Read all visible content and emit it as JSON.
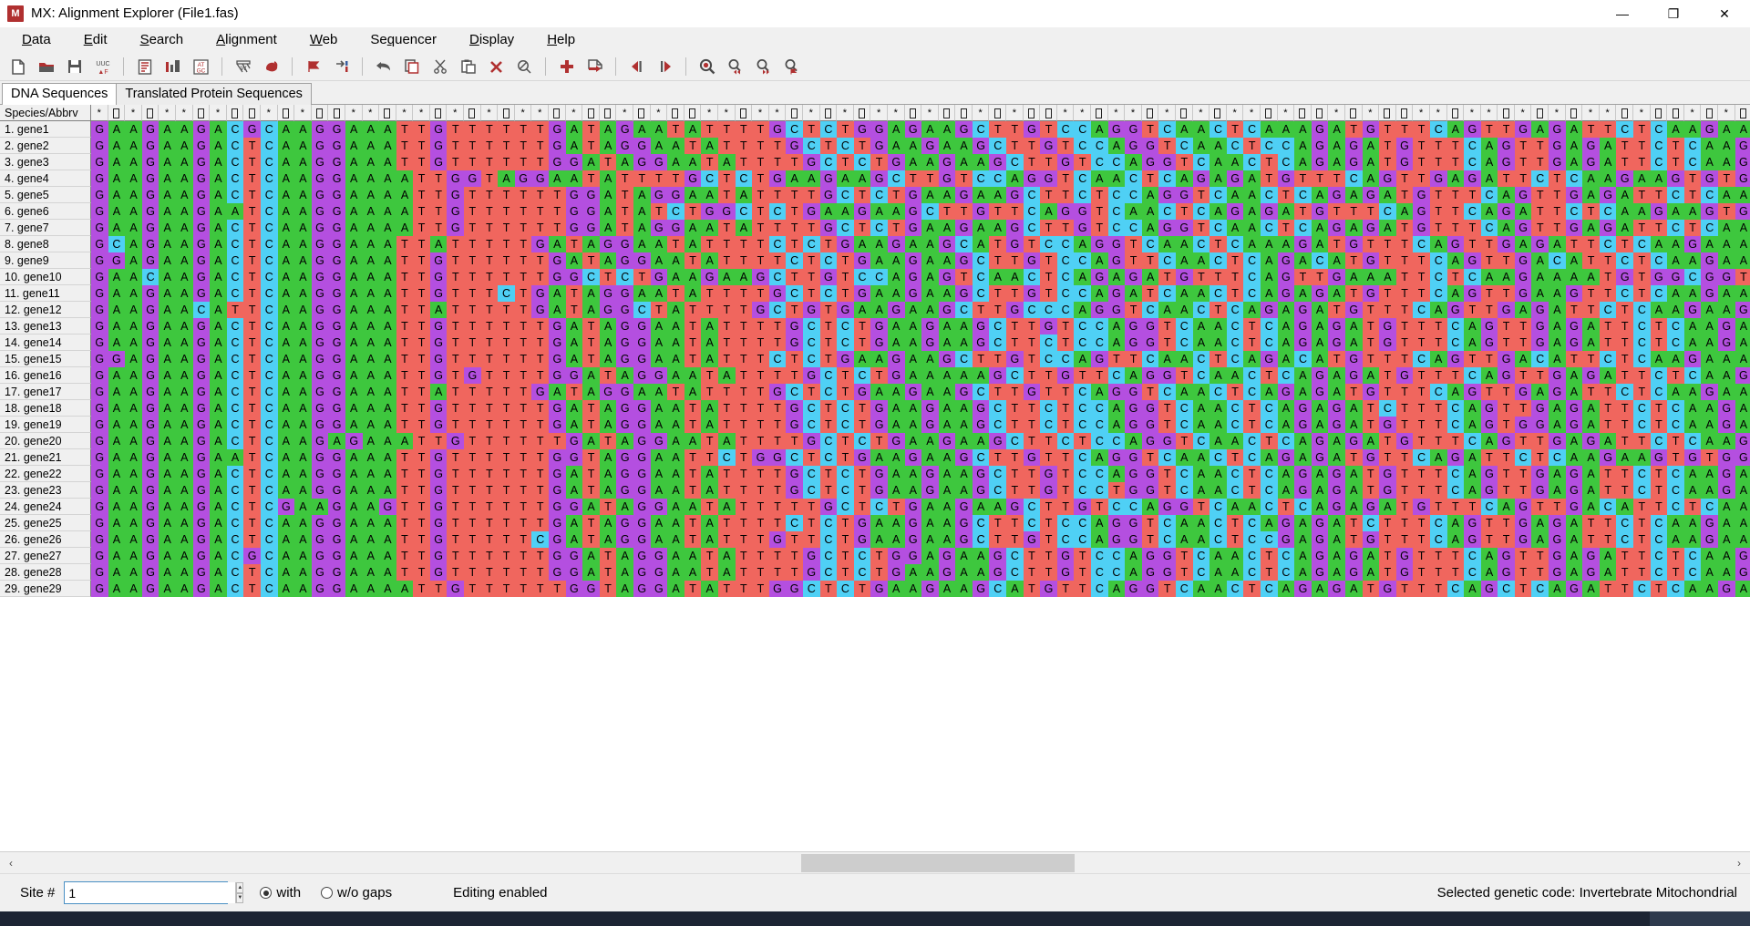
{
  "window": {
    "title": "MX: Alignment Explorer (File1.fas)",
    "app_icon_label": "M",
    "icon_color": "#b03030",
    "minimize": "—",
    "maximize": "❐",
    "close": "✕"
  },
  "menubar": {
    "items": [
      {
        "label": "Data",
        "mnemonic": "D"
      },
      {
        "label": "Edit",
        "mnemonic": "E"
      },
      {
        "label": "Search",
        "mnemonic": "S"
      },
      {
        "label": "Alignment",
        "mnemonic": "A"
      },
      {
        "label": "Web",
        "mnemonic": "W"
      },
      {
        "label": "Sequencer",
        "mnemonic": "q"
      },
      {
        "label": "Display",
        "mnemonic": "D"
      },
      {
        "label": "Help",
        "mnemonic": "H"
      }
    ]
  },
  "toolbar": {
    "buttons": [
      {
        "name": "new-file-icon",
        "glyph": "🗋",
        "color": "#555555"
      },
      {
        "name": "open-folder-icon",
        "glyph": "📁",
        "color": "#b03030"
      },
      {
        "name": "save-icon",
        "glyph": "💾",
        "color": "#555555"
      },
      {
        "name": "codon-uuc-icon",
        "glyph": "UUC",
        "color": "#555555"
      },
      {
        "name": "separator-1",
        "glyph": "",
        "color": ""
      },
      {
        "name": "text-file-icon",
        "glyph": "📄",
        "color": "#b03030"
      },
      {
        "name": "bar-chart-icon",
        "glyph": "▐▐",
        "color": "#b03030"
      },
      {
        "name": "at-gc-icon",
        "glyph": "AT",
        "color": "#b03030"
      },
      {
        "name": "separator-2",
        "glyph": "",
        "color": ""
      },
      {
        "name": "clustal-align-icon",
        "glyph": "W",
        "color": "#555555"
      },
      {
        "name": "muscle-align-icon",
        "glyph": "💪",
        "color": "#b03030"
      },
      {
        "name": "separator-3",
        "glyph": "",
        "color": ""
      },
      {
        "name": "flag-marker-icon",
        "glyph": "▶",
        "color": "#b03030"
      },
      {
        "name": "insert-marker-icon",
        "glyph": "→|",
        "color": "#555555"
      },
      {
        "name": "separator-4",
        "glyph": "",
        "color": ""
      },
      {
        "name": "undo-icon",
        "glyph": "↶",
        "color": "#555555"
      },
      {
        "name": "copy-icon",
        "glyph": "❐",
        "color": "#b03030"
      },
      {
        "name": "cut-icon",
        "glyph": "✂",
        "color": "#555555"
      },
      {
        "name": "paste-icon",
        "glyph": "📋",
        "color": "#555555"
      },
      {
        "name": "delete-icon",
        "glyph": "✘",
        "color": "#b03030"
      },
      {
        "name": "clear-icon",
        "glyph": "⌀",
        "color": "#555555"
      },
      {
        "name": "separator-5",
        "glyph": "",
        "color": ""
      },
      {
        "name": "add-icon",
        "glyph": "✚",
        "color": "#b03030"
      },
      {
        "name": "export-icon",
        "glyph": "⮞",
        "color": "#b03030"
      },
      {
        "name": "separator-6",
        "glyph": "",
        "color": ""
      },
      {
        "name": "step-left-icon",
        "glyph": "◀|",
        "color": "#b03030"
      },
      {
        "name": "step-right-icon",
        "glyph": "|▶",
        "color": "#b03030"
      },
      {
        "name": "separator-7",
        "glyph": "",
        "color": ""
      },
      {
        "name": "search-icon",
        "glyph": "🔍",
        "color": "#555555"
      },
      {
        "name": "find-prev-icon",
        "glyph": "🔍",
        "color": "#555555"
      },
      {
        "name": "find-next-icon",
        "glyph": "🔍",
        "color": "#555555"
      },
      {
        "name": "find-marked-icon",
        "glyph": "🔍",
        "color": "#555555"
      }
    ]
  },
  "tabs": [
    {
      "label": "DNA Sequences",
      "active": true
    },
    {
      "label": "Translated Protein Sequences",
      "active": false
    }
  ],
  "grid": {
    "name_column_header": "Species/Abbrv",
    "ruler_pattern": [
      "*",
      "□",
      "*",
      "□",
      "*",
      "*",
      "□",
      "*",
      "□",
      "□",
      "*",
      "□",
      "*",
      "□",
      "□",
      "*",
      "*",
      "□",
      "*",
      "*",
      "□"
    ],
    "base_colors": {
      "A": "#3ec73e",
      "C": "#4fd0f5",
      "G": "#b44fe0",
      "T": "#f0665e"
    },
    "rows": [
      {
        "index": "1.",
        "name": "gene1",
        "seq": "GAAGAAGACGCAAGGAAATTGTTTTTTGATAGAATATTTTGCTCTGGAGAAGCTTGTCCAGGTCAACTCAAAGATGTTTCAGTTGAGATTCTCAAGAAAATATGGTGGTTTGCCACTTGCAATCATCAG"
      },
      {
        "index": "2.",
        "name": "gene2",
        "seq": "GAAGAAGACTCAAGGAAATTGTTTTTTGATAGGAATATTTTGCTCTGAAGAAGCTTGTCCAGGTCAACTCCAGAGATGTTTCAGTTGAGATTCTCAAGAAAATGTGGTGGCTTGCCACTTGCAATCATTAG"
      },
      {
        "index": "3.",
        "name": "gene3",
        "seq": "GAAGAAGACTCAAGGAAATTGTTTTTTGGATAGGAATATTTTGCTCTGAAGAAGCTTGTCCAGGTCAACTCAGAGATGTTTCAGTTGAGATTCTCAAGAAGTGTGGTGGTTTGCCACTTGCAATCATTAG"
      },
      {
        "index": "4.",
        "name": "gene4",
        "seq": "GAAGAAGACTCAAGGAAAATTGGTAGGAATATTTTGCTCTGAAGAAGCTTGTCCAGGTCAACTCAGAGATGTTTCAGTTGAGATTCTCAAGAAGTGTGGTGGTTTGCCACTTGCAATCATTAG"
      },
      {
        "index": "5.",
        "name": "gene5",
        "seq": "GAAGAAGACTCAAGGAAAATTGTTTTTTGGATAGGAATATTTTGCTCTGAAGAAGCTTCTCCAGGTCAACTCAGAGATGTTTCAGTTGAGATTCTCAAGAAGTGTGGTGGTTTGACACTTGCAATCATTAG"
      },
      {
        "index": "6.",
        "name": "gene6",
        "seq": "GAAGAAGAATCAAGGAAAATTGTTTTTTGGATATCTGGCTCTGAAGAAGCTTGTTCAGGTCAACTCAGAGATGTTTCAGTTCAGATTCTCAAGAAGTGTGGTGGTTTGCCACTTGCAATCATTAG"
      },
      {
        "index": "7.",
        "name": "gene7",
        "seq": "GAAGAAGACTCAAGGAAAATTGTTTTTTGGATAGGAATATTTTGCTCTGAAGAAGCTTGTCCAGGTCAACTCAGAGATGTTTCAGTTGAGATTCTCAAGAAGTGTGGTGGTTTGCCACTTGCAATCATTAG"
      },
      {
        "index": "8.",
        "name": "gene8",
        "seq": "GCAGAAGACTCAAGGAAATTATTTTTGATAGGAATATTTTCTCTGAAGAAGCATGTCCAGGTCAACTCAAAGATGTTTCAGTTGAGATTCTCAAGAAAATGTGGTGGTATGCCACTTGCAATCATTAG"
      },
      {
        "index": "9.",
        "name": "gene9",
        "seq": "GGAGAAGACTCAAGGAAATTGTTTTTTGATAGGAATATTTTCTCTGAAGAAGCTTGTCCAGTTCAACTCAGACATGTTTCAGTTGACATTCTCAAGAAAATGTGGTGGTTTGCCACTTGCAATCATTAG"
      },
      {
        "index": "10.",
        "name": "gene10",
        "seq": "GAACAAGACTCAAGGAAATTGTTTTTTGGCTCTGAAGAAGCTTGTCCAGAGTCAACTCAGAGATGTTTCAGTTGAAATTCTCAAGAAAATGTGGCGGTCTGCCACTTGCAATCATTAG"
      },
      {
        "index": "11.",
        "name": "gene11",
        "seq": "GAAGAAGACTCAAGGAAATTGTTTCTGATAGGAATATTTTGCTCTGAAGAAGCTTGTCCAGATCAACTCAGAGATGTTTCAGTTGAAGTTCTCAAGAAGTGTGGTGGCTTGCCACTTGCAATCATTAG"
      },
      {
        "index": "12.",
        "name": "gene12",
        "seq": "GAAGAACATTCAAGGAAATTATTTTTGATAGGCTATTTTGCTGTGAAGAAGCTTGCCCAGGTCAACTCAGAGATGTTTCAGTTGAGATTCTCAAGAAGTGTGGTGGTTTGCCACTTGCAATCATCAG"
      },
      {
        "index": "13.",
        "name": "gene13",
        "seq": "GAAGAAGACTCAAGGAAATTGTTTTTTGATAGGAATATTTTGCTCTGAAGAAGCTTGTCCAGGTCAACTCAGAGATGTTTCAGTTGAGATTCTCAAGAAGTGTGGTGGTTTGCCACTTGCAATCATTTG"
      },
      {
        "index": "14.",
        "name": "gene14",
        "seq": "GAAGAAGACTCAAGGAAATTGTTTTTTGATAGGAATATTTTGCTCTGAAGAAGCTTCTCCAGGTCAACTCAGAGATGTTTCAGTTGAGATTCTCAAGAAGTGTGGTGGTTTGACACTTGCAATCATTAG"
      },
      {
        "index": "15.",
        "name": "gene15",
        "seq": "GGAGAAGACTCAAGGAAATTGTTTTTTGATAGGAATATTTCTCTGAAGAAGCTTGTCCAGTTCAACTCAGACATGTTTCAGTTGACATTCTCAAGAAAATGTGGTGGATTGCCACTTGCAATCATTAG"
      },
      {
        "index": "16.",
        "name": "gene16",
        "seq": "GAAGAAGACTCAAGGAAATTGTGTTTTGGATAGGAATATTTTGCTCTGAAAAAGCTTGTTCAGGTCAACTCAGAGATGTTTCAGTTGAGATTCTCAAGAAGTGTGGTGGTTTGCCACTTGCAATCATTAG"
      },
      {
        "index": "17.",
        "name": "gene17",
        "seq": "GAAGAAGACTCAAGGAAATTATTTTTGATAGGAATATTTTGCTCTGAAGAAGCTTGTTCAGGTCAACTCAGAGATGTTTCAGTTGAGATTCTCAAGAAGTGTGGTGGTTTGCCACTTGCAATCATTAG"
      },
      {
        "index": "18.",
        "name": "gene18",
        "seq": "GAAGAAGACTCAAGGAAATTGTTTTTTGATAGGAATATTTTGCTCTGAAGAAGCTTCTCCAGGTCAACTCAGAGATCTTTCAGTTGAGATTCTCAAGAAGTGTGGTGGTTTGCCACTTGCAATCATTAG"
      },
      {
        "index": "19.",
        "name": "gene19",
        "seq": "GAAGAAGACTCAAGGAAATTGTTTTTTGATAGGAATATTTTGCTCTGAAGAAGCTTCTCCAGGTCAACTCAGAGATGTTTCAGTGGAGATTCTCAAGAAGTGTGGTGGTCTGCCACTTGCAATCATTAG"
      },
      {
        "index": "20.",
        "name": "gene20",
        "seq": "GAAGAAGACTCAAGAGAAATTGTTTTTTGATAGGAATATTTTGCTCTGAAGAAGCTTCTCCAGGTCAACTCAGAGATGTTTCAGTTGAGATTCTCAAGAAGTGTGGTGGTTTGACACTTGCAATCATTAG"
      },
      {
        "index": "21.",
        "name": "gene21",
        "seq": "GAAGAAGAATCAAGGAAATTGTTTTTTGGTAGGAATTCTGGCTCTGAAGAAGCTTGTTCAGGTCAACTCAGAGATGTTCAGATTCTCAAGAAGTGTGGTGGTTTGCCGCTTGCAATCATTAG"
      },
      {
        "index": "22.",
        "name": "gene22",
        "seq": "GAAGAAGACTCAAGGAAATTGTTTTTTGATAGGAATATTTTGCTCTGAAGAAGCTTGTCCAGGTCAACTCAGAGATGTTTCAGTTGAGATTCTCAAGAAGTGTGGTGGTTTGCCACTTGCAATCATTAG"
      },
      {
        "index": "23.",
        "name": "gene23",
        "seq": "GAAGAAGACTCAAGGAAATTGTTTTTTGATAGGAATATTTTGCTCTGAAGAAGCTTGTCCTGGTCAACTCAGAGATGTTTCAGTTGAGATTCTCAAGAAGTGTGGTGGTTTGCCACTTGCAATCATTCA"
      },
      {
        "index": "24.",
        "name": "gene24",
        "seq": "GAAGAAGACTCGAAGAAGTTGTTTTTTGGATAGGAATATTTTTGCTCTGAAGAAGCTTGTCCAGGTCAACTCAGAGATGTTTCAGTTGACATTCTCAAGAAGTGTGGTGGTTTGCCACTTGCAATCATTAG"
      },
      {
        "index": "25.",
        "name": "gene25",
        "seq": "GAAGAAGACTCAAGGAAATTGTTTTTTGATAGGAATATTTTCTCTGAAGAAGCTTCTCCAGGTCAACTCAGAGATCTTTCAGTTGAGATTCTCAAGAAGTGTGGTGGTTTGCCACTTGCAATCATTAG"
      },
      {
        "index": "26.",
        "name": "gene26",
        "seq": "GAAGAAGACTCAAGGAAATTGTTTTTCGATAGGAATATTTGTTCTGAAGAAGCTTGTCCAGGTCAACTCCGAGATGTTTCAGTTGAGATTCTCAAGAAGTGGTGGCTTGCCACTTGCAATCATTAG"
      },
      {
        "index": "27.",
        "name": "gene27",
        "seq": "GAAGAAGACGCAAGGAAATTGTTTTTTGGATAGGAATATTTTGCTCTGGAGAAGCTTGTCCAGGTCAACTCAGAGATGTTTCAGTTGAGATTCTCAAGAAATATGGTGGTTTGCCACTTGCAATCATCAG"
      },
      {
        "index": "28.",
        "name": "gene28",
        "seq": "GAAGAAGACTCAAGGAAATTGTTTTTTGGATAGGAATATTTTGCTCTGAAGAAGCTTGTCCAGGTCAACTCAGAGATGTTTCAGTTGAGATTCTCAAGAAGTGTGGTGGTTTGCCACTTGCAATCATTAG"
      },
      {
        "index": "29.",
        "name": "gene29",
        "seq": "GAAGAAGACTCAAGGAAAATTGTTTTTTGGTAGGATATTTGGCTCTGAAGAAGCATGTTCAGGTCAACTCAGAGATGTTTCAGCTCAGATTCTCAAGAAGTGCGGTGGTTTGCCACTTGCAATCATTAG"
      }
    ]
  },
  "hscroll": {
    "left_arrow": "‹",
    "right_arrow": "›"
  },
  "statusbar": {
    "site_label": "Site #",
    "site_value": "1",
    "site_placeholder": "",
    "spin_up": "▲",
    "spin_down": "▼",
    "radio_with": "with",
    "radio_without": "w/o gaps",
    "radio_selected": "with",
    "editing_status": "Editing enabled",
    "genetic_code": "Selected genetic code: Invertebrate Mitochondrial"
  }
}
